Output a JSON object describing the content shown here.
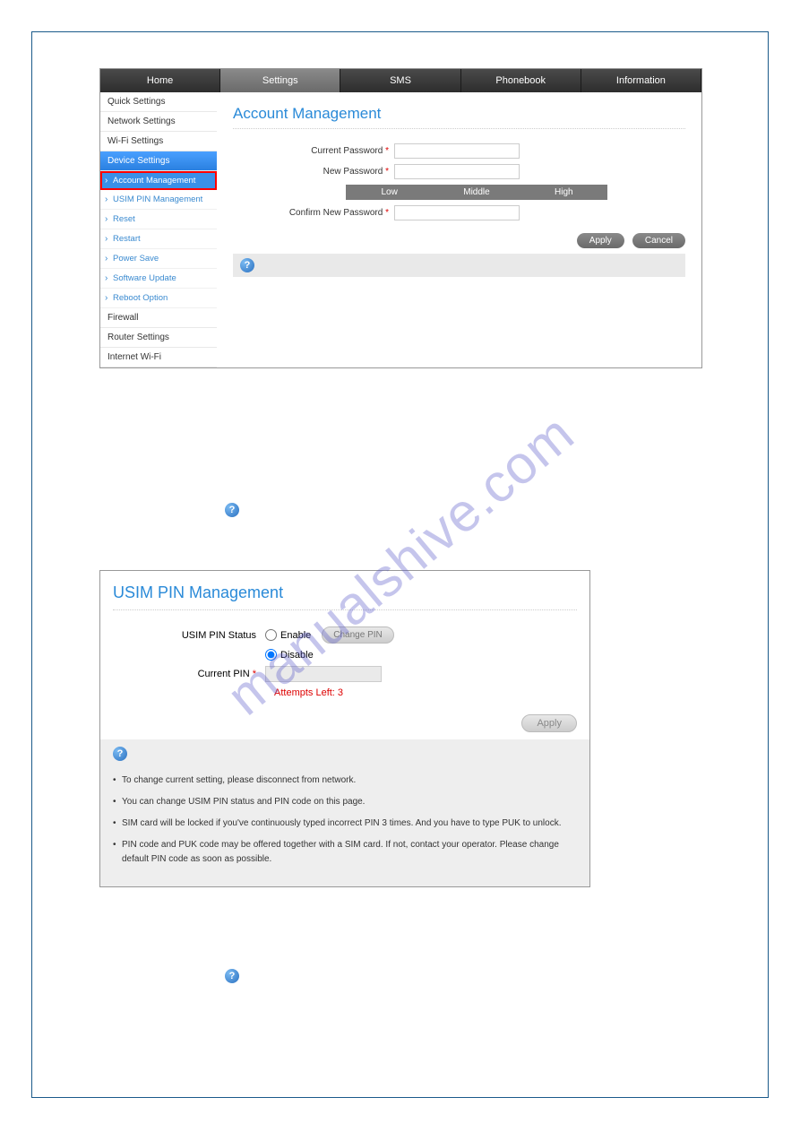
{
  "watermark": "manualshive.com",
  "topnav": {
    "items": [
      "Home",
      "Settings",
      "SMS",
      "Phonebook",
      "Information"
    ],
    "active": 1
  },
  "sidebar": {
    "items": [
      {
        "label": "Quick Settings",
        "type": "item"
      },
      {
        "label": "Network Settings",
        "type": "item"
      },
      {
        "label": "Wi-Fi Settings",
        "type": "item"
      },
      {
        "label": "Device Settings",
        "type": "item",
        "active": true
      },
      {
        "label": "Account Management",
        "type": "sub",
        "highlight": true
      },
      {
        "label": "USIM PIN Management",
        "type": "sub"
      },
      {
        "label": "Reset",
        "type": "sub"
      },
      {
        "label": "Restart",
        "type": "sub"
      },
      {
        "label": "Power Save",
        "type": "sub"
      },
      {
        "label": "Software Update",
        "type": "sub"
      },
      {
        "label": "Reboot Option",
        "type": "sub"
      },
      {
        "label": "Firewall",
        "type": "item"
      },
      {
        "label": "Router Settings",
        "type": "item"
      },
      {
        "label": "Internet Wi-Fi",
        "type": "item"
      }
    ]
  },
  "account_mgmt": {
    "title": "Account Management",
    "fields": {
      "current_pw": "Current Password",
      "new_pw": "New Password",
      "confirm_pw": "Confirm New Password"
    },
    "strength": [
      "Low",
      "Middle",
      "High"
    ],
    "apply": "Apply",
    "cancel": "Cancel"
  },
  "usim": {
    "title": "USIM PIN Management",
    "status_label": "USIM PIN Status",
    "enable": "Enable",
    "disable": "Disable",
    "change_pin": "Change PIN",
    "current_pin": "Current PIN",
    "attempts": "Attempts Left: 3",
    "apply": "Apply",
    "help_items": [
      "To change current setting, please disconnect from network.",
      "You can change USIM PIN status and PIN code on this page.",
      "SIM card will be locked if you've continuously typed incorrect PIN 3 times. And you have to type PUK to unlock.",
      "PIN code and PUK code may be offered together with a SIM card. If not, contact your operator. Please change default PIN code as soon as possible."
    ]
  }
}
